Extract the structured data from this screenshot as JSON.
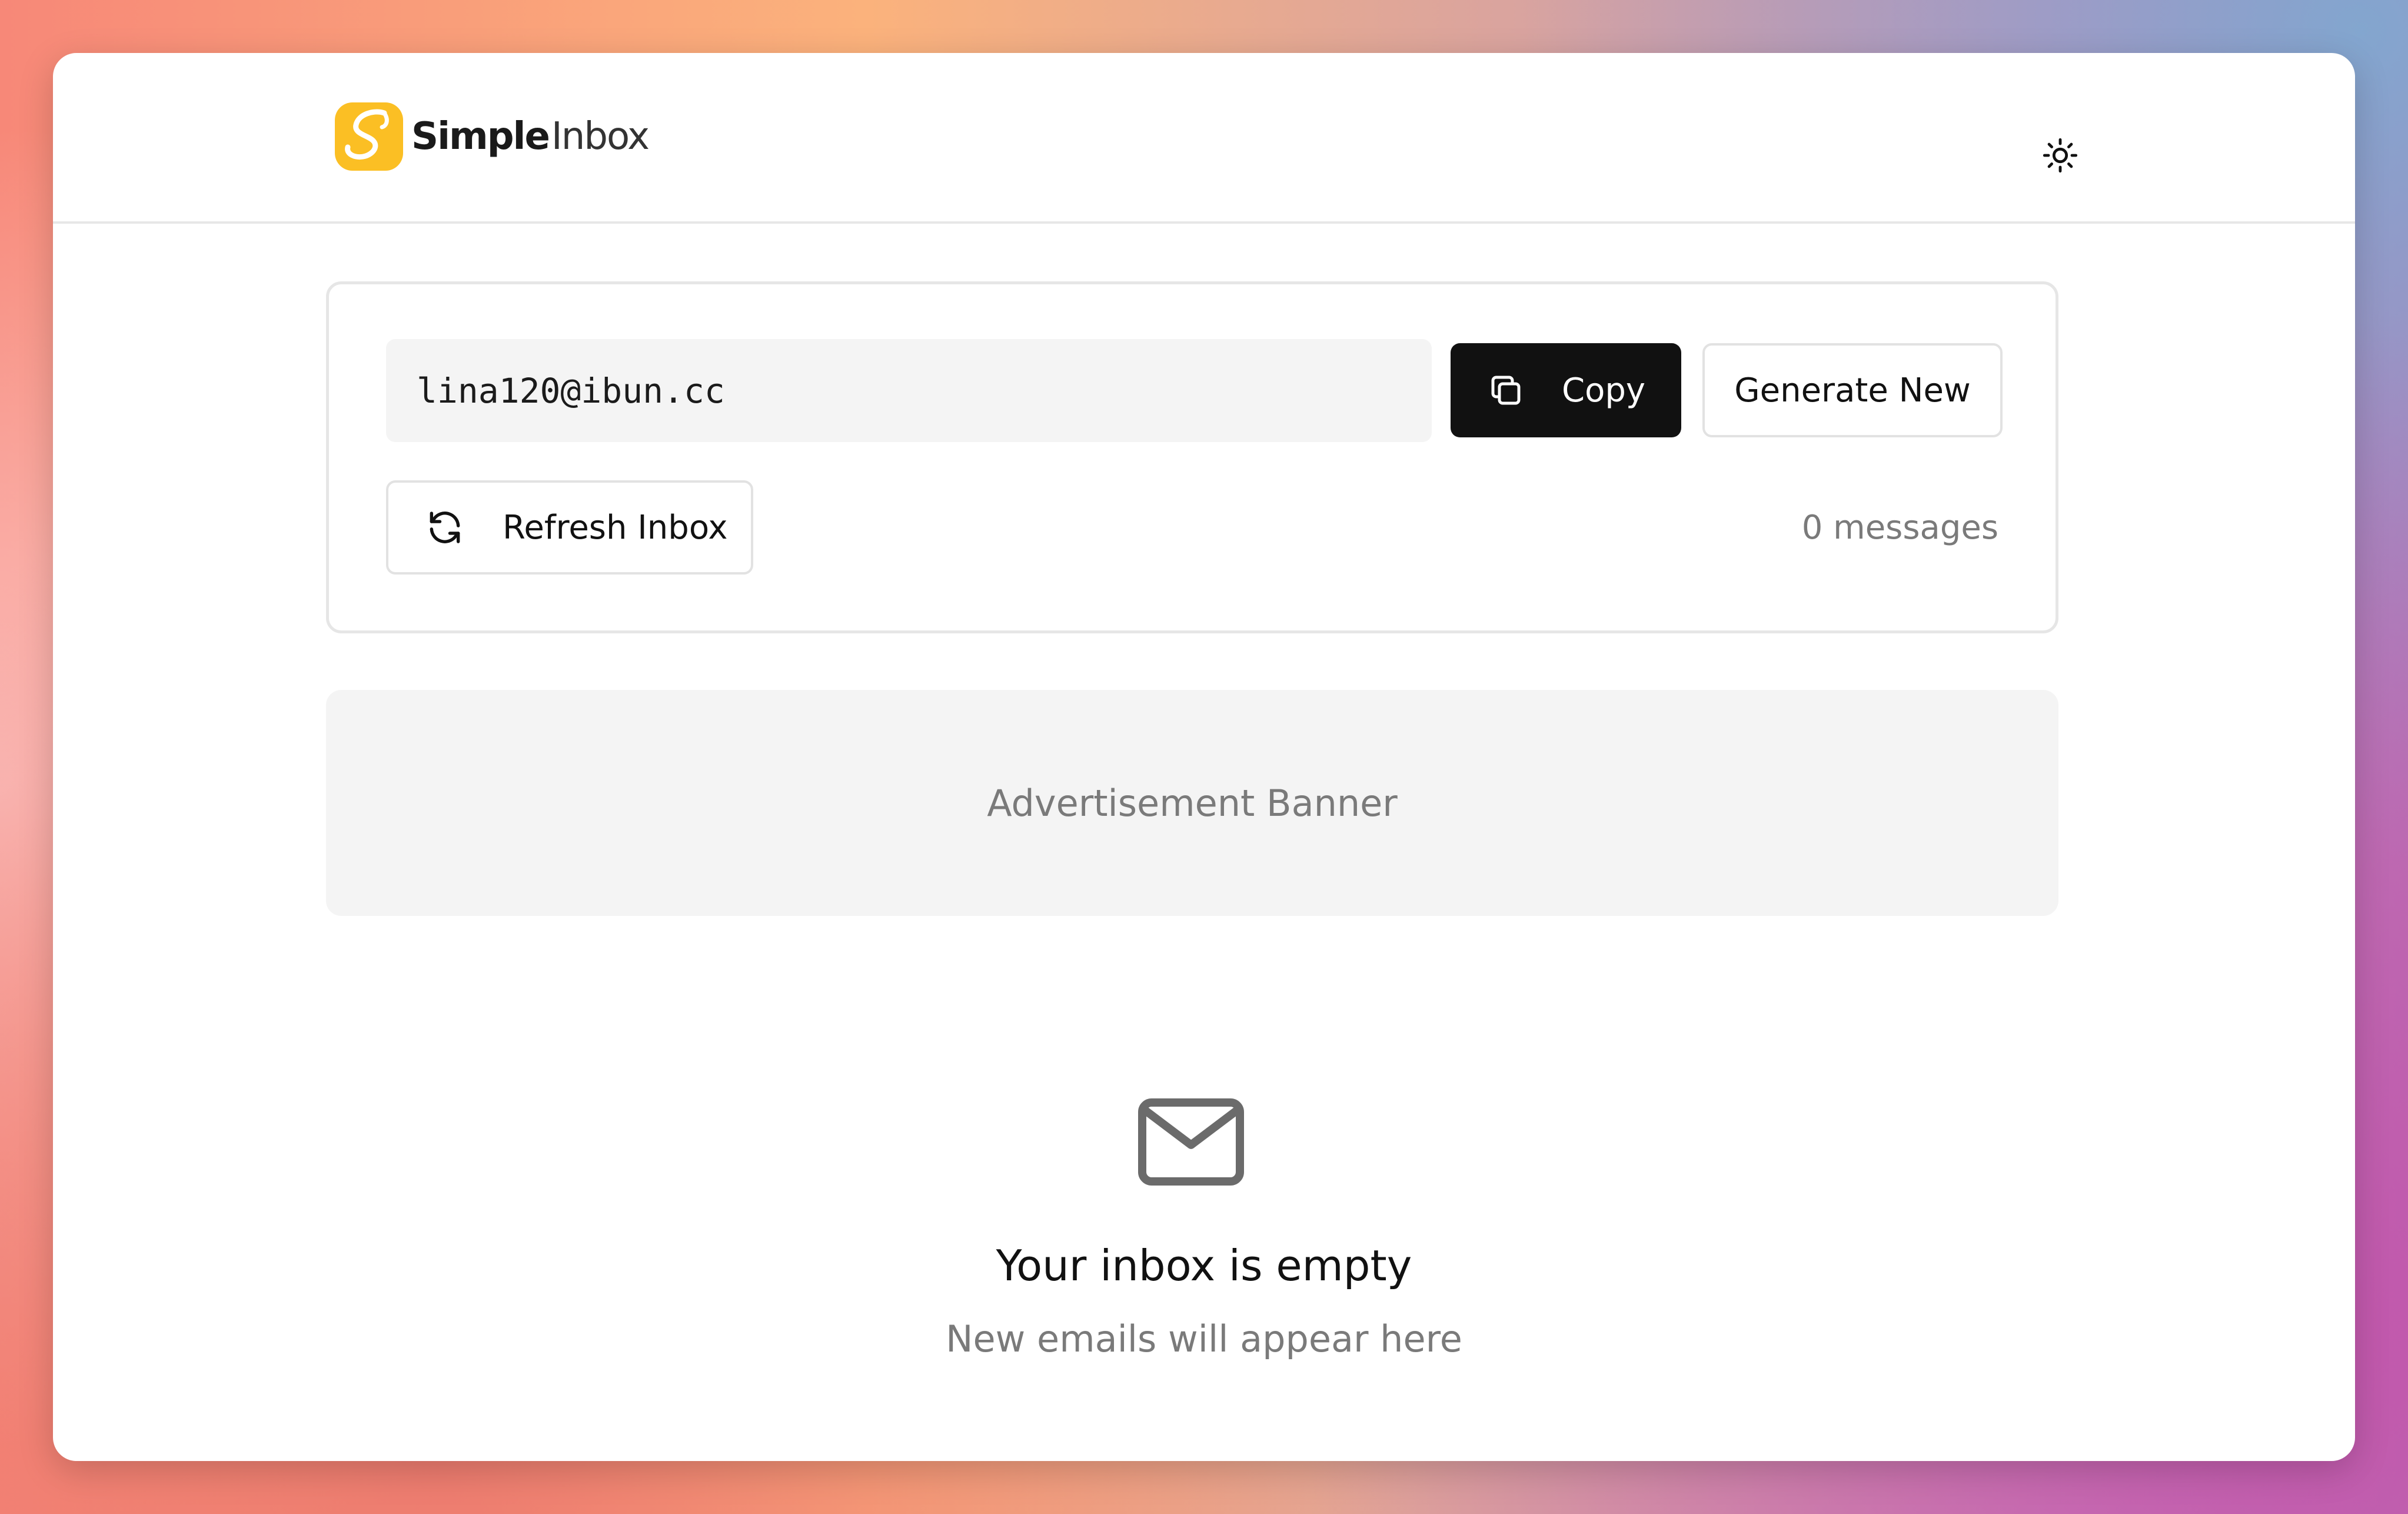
{
  "brand": {
    "name_bold": "Simple",
    "name_light": "Inbox",
    "logo_color": "#fbbf24"
  },
  "header": {
    "theme_icon": "sun-icon"
  },
  "address_panel": {
    "email": "lina120@ibun.cc",
    "copy_label": "Copy",
    "generate_label": "Generate New",
    "refresh_label": "Refresh Inbox",
    "message_count": "0 messages"
  },
  "ad": {
    "label": "Advertisement Banner"
  },
  "empty_state": {
    "icon": "mail-icon",
    "title": "Your inbox is empty",
    "subtitle": "New emails will appear here"
  },
  "colors": {
    "primary_button": "#111111",
    "muted_text": "#7a7a7a",
    "surface_gray": "#f4f4f4"
  }
}
